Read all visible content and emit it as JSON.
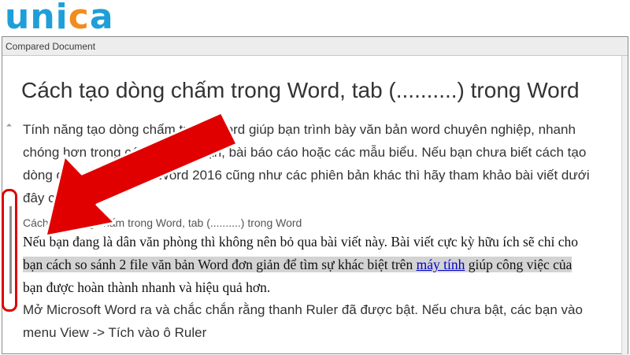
{
  "brand": {
    "logo_letters": [
      "u",
      "n",
      "i",
      "c",
      "a"
    ],
    "logo_colors": {
      "primary": "#1f9fd8",
      "accent": "#f28c1f"
    }
  },
  "window": {
    "title": "Compared Document"
  },
  "document": {
    "heading": "Cách tạo dòng chấm trong Word, tab (..........) trong Word",
    "paragraph_1_lines": [
      "Tính năng tạo dòng chấm trong Word giúp bạn trình bày văn bản word chuyên nghiệp, nhanh",
      "chóng hơn trong các bài tiểu luận, bài báo cáo hoặc các mẫu biểu. Nếu bạn chưa biết cách tạo",
      "dòng dấm chấm trong Word 2016 cũng như các phiên bản khác thì hãy tham khảo bài viết dưới",
      "đây của mình."
    ],
    "caption": "Cách tạo dòng chấm trong Word, tab (..........) trong Word",
    "changed_paragraph": {
      "line_1": "Nếu bạn đang là dân văn phòng thì không nên bỏ qua bài viết này. Bài viết cực kỳ hữu ích sẽ chỉ cho",
      "line_2_before_link": "bạn cách so sánh 2 file văn bản Word đơn giản để tìm sự khác biệt trên ",
      "link_text": "máy tính",
      "line_2_after_link": " giúp công việc của",
      "line_3": "bạn được hoàn thành nhanh và hiệu quả hơn."
    },
    "paragraph_2_lines": [
      "Mở Microsoft Word ra và chắc chắn rằng thanh Ruler đã được bật. Nếu chưa bật, các bạn vào",
      "menu View -> Tích vào ô Ruler"
    ]
  },
  "annotation": {
    "arrow_color": "#e00000",
    "highlight_color": "#d3d3d3",
    "change_bar_color": "#8c8c8c"
  }
}
